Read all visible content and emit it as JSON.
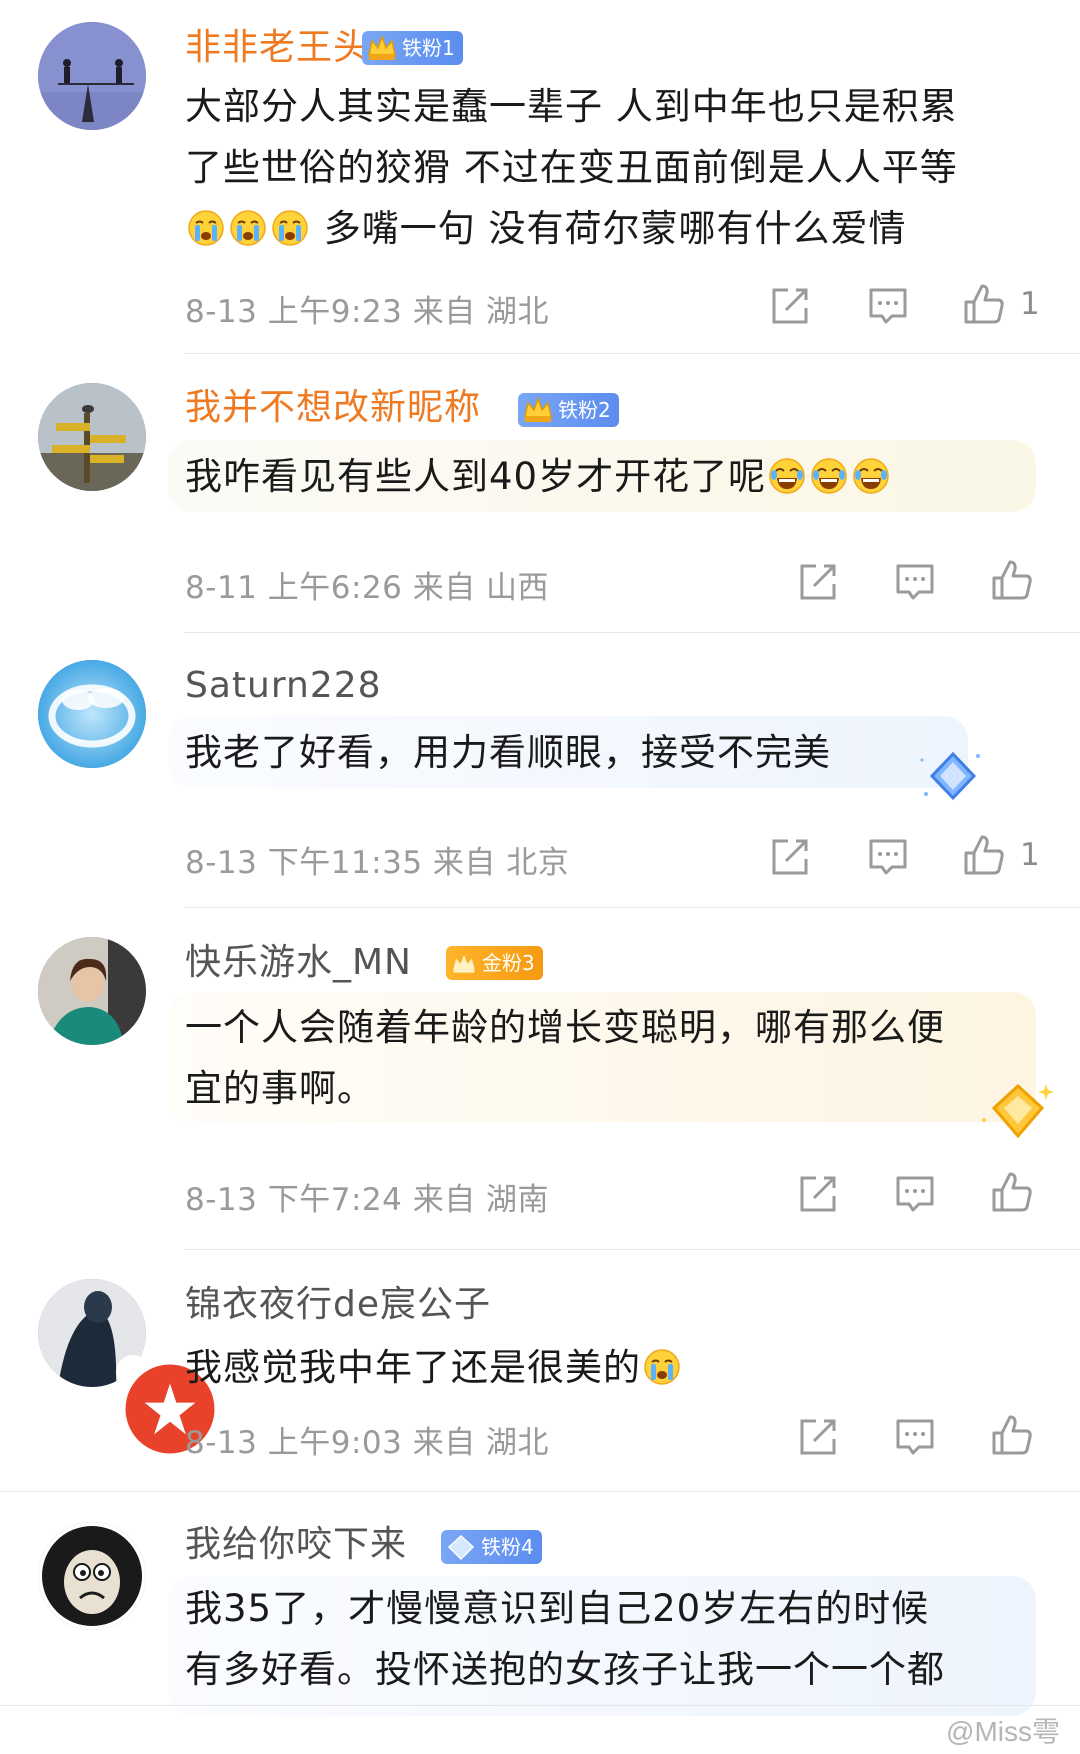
{
  "comments": [
    {
      "name": "非非老王头",
      "badge": "铁粉1",
      "text_lines": [
        "大部分人其实是蠢一辈子  人到中年也只是积累",
        "了些世俗的狡猾  不过在变丑面前倒是人人平等"
      ],
      "text_tail": "多嘴一句 没有荷尔蒙哪有什么爱情",
      "emojis": [
        "crying-emoji",
        "crying-emoji",
        "crying-emoji"
      ],
      "date": "8-13",
      "time": "上午9:23",
      "from": "来自 湖北",
      "likes": "1"
    },
    {
      "name": "我并不想改新昵称",
      "badge": "铁粉2",
      "text": "我咋看见有些人到40岁才开花了呢",
      "emojis": [
        "laughing-emoji",
        "laughing-emoji",
        "laughing-emoji"
      ],
      "date": "8-11",
      "time": "上午6:26",
      "from": "来自 山西",
      "likes": ""
    },
    {
      "name": "Saturn228",
      "text": "我老了好看，用力看顺眼，接受不完美",
      "date": "8-13",
      "time": "下午11:35",
      "from": "来自 北京",
      "likes": "1"
    },
    {
      "name": "快乐游水_MN",
      "badge": "金粉3",
      "text_lines": [
        "一个人会随着年龄的增长变聪明，哪有那么便",
        "宜的事啊。"
      ],
      "date": "8-13",
      "time": "下午7:24",
      "from": "来自 湖南",
      "likes": ""
    },
    {
      "name": "锦衣夜行de宸公子",
      "text": "我感觉我中年了还是很美的",
      "emojis": [
        "crying-emoji"
      ],
      "date": "8-13",
      "time": "上午9:03",
      "from": "来自 湖北",
      "likes": ""
    },
    {
      "name": "我给你咬下来",
      "badge": "铁粉4",
      "text_lines": [
        "我35了，才慢慢意识到自己20岁左右的时候",
        "有多好看。投怀送抱的女孩子让我一个一个都"
      ]
    }
  ],
  "watermark": "@Miss雩",
  "colors": {
    "vip_name": "#ef7a22",
    "name": "#555555",
    "meta": "#9a9a9a",
    "badge_blue": "#5b8df0",
    "badge_gold": "#f59a12"
  }
}
